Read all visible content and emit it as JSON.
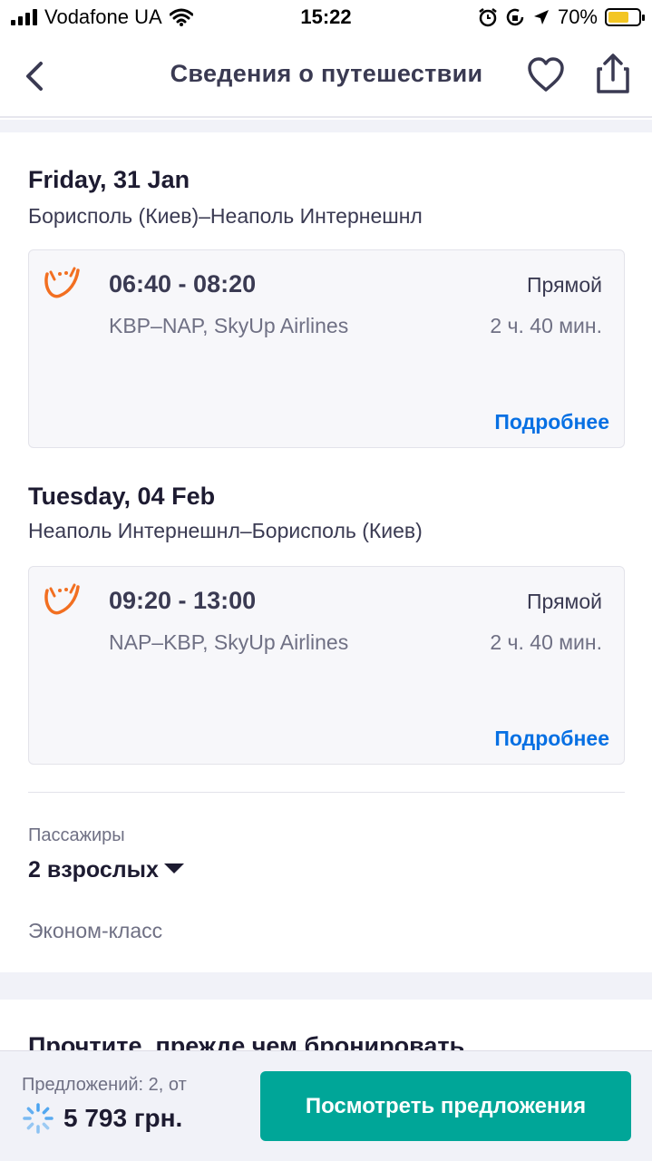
{
  "status_bar": {
    "carrier": "Vodafone UA",
    "time": "15:22",
    "battery": "70%",
    "battery_level": 0.7
  },
  "header": {
    "title": "Сведения о путешествии"
  },
  "legs": [
    {
      "date": "Friday, 31 Jan",
      "route": "Борисполь (Киев)–Неаполь Интернешнл",
      "times": "06:40 - 08:20",
      "stops": "Прямой",
      "info": "KBP–NAP, SkyUp Airlines",
      "duration": "2 ч. 40 мин.",
      "more": "Подробнее"
    },
    {
      "date": "Tuesday, 04 Feb",
      "route": "Неаполь Интернешнл–Борисполь (Киев)",
      "times": "09:20 - 13:00",
      "stops": "Прямой",
      "info": "NAP–KBP, SkyUp Airlines",
      "duration": "2 ч. 40 мин.",
      "more": "Подробнее"
    }
  ],
  "passengers": {
    "label": "Пассажиры",
    "value": "2 взрослых",
    "cabin": "Эконом-класс"
  },
  "read_before": {
    "title": "Прочтите, прежде чем бронировать"
  },
  "bottom": {
    "offers_label": "Предложений: 2, от",
    "price": "5 793 грн.",
    "cta": "Посмотреть предложения"
  },
  "colors": {
    "accent": "#0770e3",
    "cta": "#00a698",
    "airline_logo": "#f26f21"
  }
}
